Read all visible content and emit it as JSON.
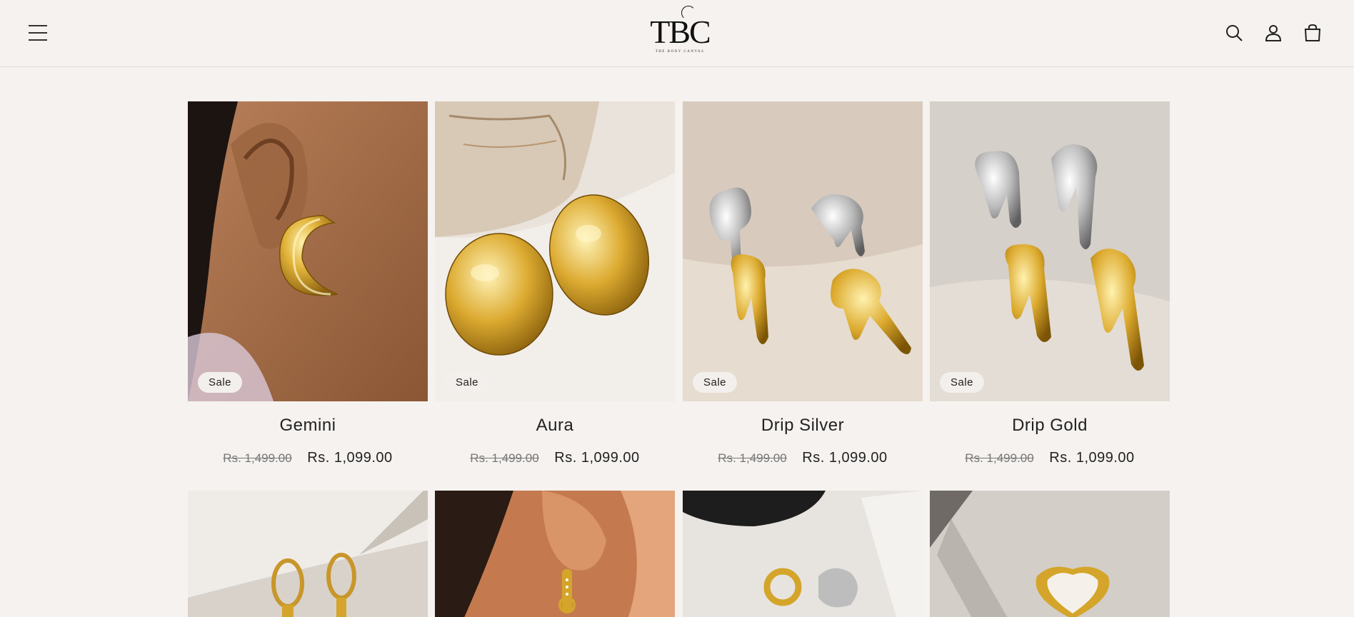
{
  "header": {
    "menu_icon": "hamburger-menu-icon",
    "logo_text": "TBC",
    "logo_subtitle": "THE BODY CANVAS",
    "icons": [
      "search-icon",
      "account-icon",
      "cart-icon"
    ]
  },
  "products": [
    {
      "title": "Gemini",
      "badge": "Sale",
      "compare_price": "Rs. 1,499.00",
      "price": "Rs. 1,099.00"
    },
    {
      "title": "Aura",
      "badge": "Sale",
      "compare_price": "Rs. 1,499.00",
      "price": "Rs. 1,099.00"
    },
    {
      "title": "Drip Silver",
      "badge": "Sale",
      "compare_price": "Rs. 1,499.00",
      "price": "Rs. 1,099.00"
    },
    {
      "title": "Drip Gold",
      "badge": "Sale",
      "compare_price": "Rs. 1,499.00",
      "price": "Rs. 1,099.00"
    }
  ],
  "colors": {
    "background": "#f5f2ef",
    "text": "#222222",
    "gold": "#d4a52a",
    "silver": "#bdbdbd"
  }
}
